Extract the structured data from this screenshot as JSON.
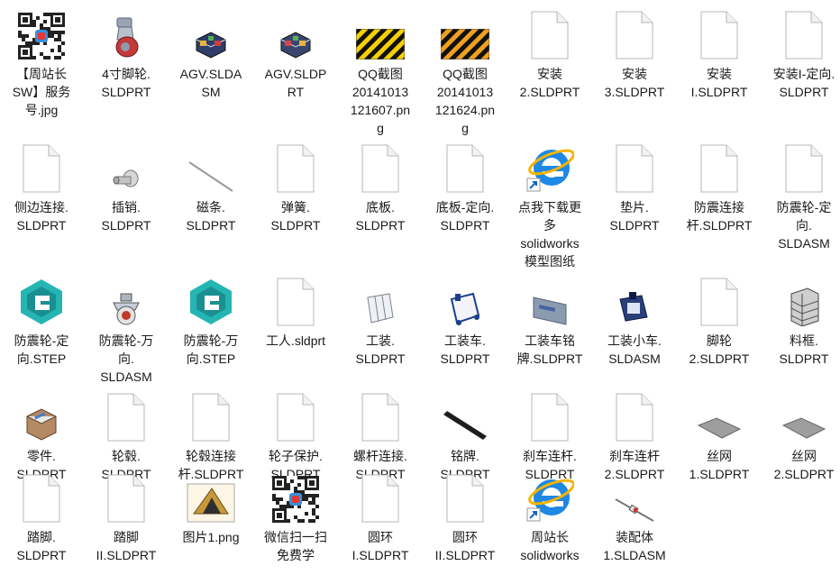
{
  "files": [
    {
      "name": "【周站长SW】服务号.jpg",
      "icon": "qr-code-image-icon",
      "label_lines": [
        "【周站长",
        "SW】服务",
        "号.jpg"
      ]
    },
    {
      "name": "4寸脚轮.SLDPRT",
      "icon": "caster-wheel-model-icon",
      "label_lines": [
        "4寸脚轮.",
        "SLDPRT"
      ]
    },
    {
      "name": "AGV.SLDASM",
      "icon": "agv-assembly-model-icon",
      "label_lines": [
        "AGV.SLDA",
        "SM"
      ]
    },
    {
      "name": "AGV.SLDPRT",
      "icon": "agv-part-model-icon",
      "label_lines": [
        "AGV.SLDP",
        "RT"
      ]
    },
    {
      "name": "QQ截图20141013121607.png",
      "icon": "hazard-stripe-image-icon",
      "label_lines": [
        "QQ截图",
        "20141013",
        "121607.pn",
        "g"
      ]
    },
    {
      "name": "QQ截图20141013121624.png",
      "icon": "hazard-stripe-orange-image-icon",
      "label_lines": [
        "QQ截图",
        "20141013",
        "121624.pn",
        "g"
      ]
    },
    {
      "name": "安装2.SLDPRT",
      "icon": "blank-file-icon",
      "label_lines": [
        "安装",
        "2.SLDPRT"
      ]
    },
    {
      "name": "安装3.SLDPRT",
      "icon": "blank-file-icon",
      "label_lines": [
        "安装",
        "3.SLDPRT"
      ]
    },
    {
      "name": "安装I.SLDPRT",
      "icon": "blank-file-icon",
      "label_lines": [
        "安装",
        "I.SLDPRT"
      ]
    },
    {
      "name": "安装I-定向.SLDPRT",
      "icon": "blank-file-icon",
      "label_lines": [
        "安装I-定向.",
        "SLDPRT"
      ]
    },
    {
      "name": "侧边连接.SLDPRT",
      "icon": "blank-file-icon",
      "label_lines": [
        "侧边连接.",
        "SLDPRT"
      ]
    },
    {
      "name": "插销.SLDPRT",
      "icon": "pin-model-icon",
      "label_lines": [
        "插销.",
        "SLDPRT"
      ]
    },
    {
      "name": "磁条.SLDPRT",
      "icon": "magnetic-strip-model-icon",
      "label_lines": [
        "磁条.",
        "SLDPRT"
      ]
    },
    {
      "name": "弹簧.SLDPRT",
      "icon": "blank-file-icon",
      "label_lines": [
        "弹簧.",
        "SLDPRT"
      ]
    },
    {
      "name": "底板.SLDPRT",
      "icon": "blank-file-icon",
      "label_lines": [
        "底板.",
        "SLDPRT"
      ]
    },
    {
      "name": "底板-定向.SLDPRT",
      "icon": "blank-file-icon",
      "label_lines": [
        "底板-定向.",
        "SLDPRT"
      ]
    },
    {
      "name": "点我下载更多solidworks模型图纸",
      "icon": "internet-explorer-shortcut-icon",
      "label_lines": [
        "点我下载更",
        "多",
        "solidworks",
        "模型图纸"
      ]
    },
    {
      "name": "垫片.SLDPRT",
      "icon": "blank-file-icon",
      "label_lines": [
        "垫片.",
        "SLDPRT"
      ]
    },
    {
      "name": "防震连接杆.SLDPRT",
      "icon": "blank-file-icon",
      "label_lines": [
        "防震连接",
        "杆.SLDPRT"
      ]
    },
    {
      "name": "防震轮-定向.SLDASM",
      "icon": "blank-file-icon",
      "label_lines": [
        "防震轮-定",
        "向.",
        "SLDASM"
      ]
    },
    {
      "name": "防震轮-定向.STEP",
      "icon": "step-file-logo-icon",
      "label_lines": [
        "防震轮-定",
        "向.STEP"
      ]
    },
    {
      "name": "防震轮-万向.SLDASM",
      "icon": "shock-wheel-model-icon",
      "label_lines": [
        "防震轮-万",
        "向.",
        "SLDASM"
      ]
    },
    {
      "name": "防震轮-万向.STEP",
      "icon": "step-file-logo-icon",
      "label_lines": [
        "防震轮-万",
        "向.STEP"
      ]
    },
    {
      "name": "工人.sldprt",
      "icon": "blank-file-icon",
      "label_lines": [
        "工人.sldprt"
      ]
    },
    {
      "name": "工装.SLDPRT",
      "icon": "fixture-frame-model-icon",
      "label_lines": [
        "工装.",
        "SLDPRT"
      ]
    },
    {
      "name": "工装车.SLDPRT",
      "icon": "fixture-cart-model-icon",
      "label_lines": [
        "工装车.",
        "SLDPRT"
      ]
    },
    {
      "name": "工装车铭牌.SLDPRT",
      "icon": "nameplate-model-icon",
      "label_lines": [
        "工装车铭",
        "牌.SLDPRT"
      ]
    },
    {
      "name": "工装小车.SLDASM",
      "icon": "small-cart-model-icon",
      "label_lines": [
        "工装小车.",
        "SLDASM"
      ]
    },
    {
      "name": "脚轮2.SLDPRT",
      "icon": "blank-file-icon",
      "label_lines": [
        "脚轮",
        "2.SLDPRT"
      ]
    },
    {
      "name": "料框.SLDPRT",
      "icon": "material-rack-model-icon",
      "label_lines": [
        "料框.",
        "SLDPRT"
      ]
    },
    {
      "name": "零件.SLDPRT",
      "icon": "part-box-model-icon",
      "label_lines": [
        "零件.",
        "SLDPRT"
      ]
    },
    {
      "name": "轮毂.SLDPRT",
      "icon": "blank-file-icon",
      "label_lines": [
        "轮毂.",
        "SLDPRT"
      ]
    },
    {
      "name": "轮毂连接杆.SLDPRT",
      "icon": "blank-file-icon",
      "label_lines": [
        "轮毂连接",
        "杆.SLDPRT"
      ]
    },
    {
      "name": "轮子保护.SLDPRT",
      "icon": "blank-file-icon",
      "label_lines": [
        "轮子保护.",
        "SLDPRT"
      ]
    },
    {
      "name": "螺杆连接.SLDPRT",
      "icon": "blank-file-icon",
      "label_lines": [
        "螺杆连接.",
        "SLDPRT"
      ]
    },
    {
      "name": "铭牌.SLDPRT",
      "icon": "black-bar-model-icon",
      "label_lines": [
        "铭牌.",
        "SLDPRT"
      ]
    },
    {
      "name": "刹车连杆.SLDPRT",
      "icon": "blank-file-icon",
      "label_lines": [
        "刹车连杆.",
        "SLDPRT"
      ]
    },
    {
      "name": "刹车连杆2.SLDPRT",
      "icon": "blank-file-icon",
      "label_lines": [
        "刹车连杆",
        "2.SLDPRT"
      ]
    },
    {
      "name": "丝网1.SLDPRT",
      "icon": "wire-mesh-model-icon",
      "label_lines": [
        "丝网",
        "1.SLDPRT"
      ]
    },
    {
      "name": "丝网2.SLDPRT",
      "icon": "wire-mesh-model-icon",
      "label_lines": [
        "丝网",
        "2.SLDPRT"
      ]
    },
    {
      "name": "踏脚.SLDPRT",
      "icon": "blank-file-icon",
      "label_lines": [
        "踏脚.",
        "SLDPRT"
      ]
    },
    {
      "name": "踏脚II.SLDPRT",
      "icon": "blank-file-icon",
      "label_lines": [
        "踏脚",
        "II.SLDPRT"
      ]
    },
    {
      "name": "图片1.png",
      "icon": "picture-image-icon",
      "label_lines": [
        "图片1.png"
      ]
    },
    {
      "name": "微信扫一扫免费学",
      "icon": "qr-code-image-icon",
      "label_lines": [
        "微信扫一扫",
        "免费学"
      ]
    },
    {
      "name": "圆环I.SLDPRT",
      "icon": "blank-file-icon",
      "label_lines": [
        "圆环",
        "I.SLDPRT"
      ]
    },
    {
      "name": "圆环II.SLDPRT",
      "icon": "blank-file-icon",
      "label_lines": [
        "圆环",
        "II.SLDPRT"
      ]
    },
    {
      "name": "周站长solidworks",
      "icon": "internet-explorer-shortcut-icon",
      "label_lines": [
        "周站长",
        "solidworks"
      ]
    },
    {
      "name": "装配体1.SLDASM",
      "icon": "assembly-rod-model-icon",
      "label_lines": [
        "装配体",
        "1.SLDASM"
      ]
    }
  ]
}
